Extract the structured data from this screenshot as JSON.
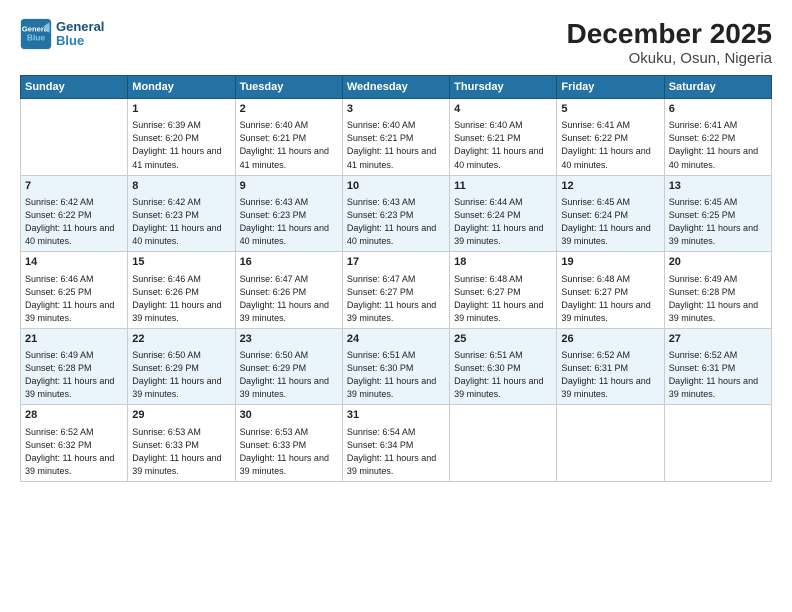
{
  "header": {
    "logo_line1": "General",
    "logo_line2": "Blue",
    "title": "December 2025",
    "subtitle": "Okuku, Osun, Nigeria"
  },
  "columns": [
    "Sunday",
    "Monday",
    "Tuesday",
    "Wednesday",
    "Thursday",
    "Friday",
    "Saturday"
  ],
  "weeks": [
    [
      {
        "day": "",
        "sunrise": "",
        "sunset": "",
        "daylight": ""
      },
      {
        "day": "1",
        "sunrise": "Sunrise: 6:39 AM",
        "sunset": "Sunset: 6:20 PM",
        "daylight": "Daylight: 11 hours and 41 minutes."
      },
      {
        "day": "2",
        "sunrise": "Sunrise: 6:40 AM",
        "sunset": "Sunset: 6:21 PM",
        "daylight": "Daylight: 11 hours and 41 minutes."
      },
      {
        "day": "3",
        "sunrise": "Sunrise: 6:40 AM",
        "sunset": "Sunset: 6:21 PM",
        "daylight": "Daylight: 11 hours and 41 minutes."
      },
      {
        "day": "4",
        "sunrise": "Sunrise: 6:40 AM",
        "sunset": "Sunset: 6:21 PM",
        "daylight": "Daylight: 11 hours and 40 minutes."
      },
      {
        "day": "5",
        "sunrise": "Sunrise: 6:41 AM",
        "sunset": "Sunset: 6:22 PM",
        "daylight": "Daylight: 11 hours and 40 minutes."
      },
      {
        "day": "6",
        "sunrise": "Sunrise: 6:41 AM",
        "sunset": "Sunset: 6:22 PM",
        "daylight": "Daylight: 11 hours and 40 minutes."
      }
    ],
    [
      {
        "day": "7",
        "sunrise": "Sunrise: 6:42 AM",
        "sunset": "Sunset: 6:22 PM",
        "daylight": "Daylight: 11 hours and 40 minutes."
      },
      {
        "day": "8",
        "sunrise": "Sunrise: 6:42 AM",
        "sunset": "Sunset: 6:23 PM",
        "daylight": "Daylight: 11 hours and 40 minutes."
      },
      {
        "day": "9",
        "sunrise": "Sunrise: 6:43 AM",
        "sunset": "Sunset: 6:23 PM",
        "daylight": "Daylight: 11 hours and 40 minutes."
      },
      {
        "day": "10",
        "sunrise": "Sunrise: 6:43 AM",
        "sunset": "Sunset: 6:23 PM",
        "daylight": "Daylight: 11 hours and 40 minutes."
      },
      {
        "day": "11",
        "sunrise": "Sunrise: 6:44 AM",
        "sunset": "Sunset: 6:24 PM",
        "daylight": "Daylight: 11 hours and 39 minutes."
      },
      {
        "day": "12",
        "sunrise": "Sunrise: 6:45 AM",
        "sunset": "Sunset: 6:24 PM",
        "daylight": "Daylight: 11 hours and 39 minutes."
      },
      {
        "day": "13",
        "sunrise": "Sunrise: 6:45 AM",
        "sunset": "Sunset: 6:25 PM",
        "daylight": "Daylight: 11 hours and 39 minutes."
      }
    ],
    [
      {
        "day": "14",
        "sunrise": "Sunrise: 6:46 AM",
        "sunset": "Sunset: 6:25 PM",
        "daylight": "Daylight: 11 hours and 39 minutes."
      },
      {
        "day": "15",
        "sunrise": "Sunrise: 6:46 AM",
        "sunset": "Sunset: 6:26 PM",
        "daylight": "Daylight: 11 hours and 39 minutes."
      },
      {
        "day": "16",
        "sunrise": "Sunrise: 6:47 AM",
        "sunset": "Sunset: 6:26 PM",
        "daylight": "Daylight: 11 hours and 39 minutes."
      },
      {
        "day": "17",
        "sunrise": "Sunrise: 6:47 AM",
        "sunset": "Sunset: 6:27 PM",
        "daylight": "Daylight: 11 hours and 39 minutes."
      },
      {
        "day": "18",
        "sunrise": "Sunrise: 6:48 AM",
        "sunset": "Sunset: 6:27 PM",
        "daylight": "Daylight: 11 hours and 39 minutes."
      },
      {
        "day": "19",
        "sunrise": "Sunrise: 6:48 AM",
        "sunset": "Sunset: 6:27 PM",
        "daylight": "Daylight: 11 hours and 39 minutes."
      },
      {
        "day": "20",
        "sunrise": "Sunrise: 6:49 AM",
        "sunset": "Sunset: 6:28 PM",
        "daylight": "Daylight: 11 hours and 39 minutes."
      }
    ],
    [
      {
        "day": "21",
        "sunrise": "Sunrise: 6:49 AM",
        "sunset": "Sunset: 6:28 PM",
        "daylight": "Daylight: 11 hours and 39 minutes."
      },
      {
        "day": "22",
        "sunrise": "Sunrise: 6:50 AM",
        "sunset": "Sunset: 6:29 PM",
        "daylight": "Daylight: 11 hours and 39 minutes."
      },
      {
        "day": "23",
        "sunrise": "Sunrise: 6:50 AM",
        "sunset": "Sunset: 6:29 PM",
        "daylight": "Daylight: 11 hours and 39 minutes."
      },
      {
        "day": "24",
        "sunrise": "Sunrise: 6:51 AM",
        "sunset": "Sunset: 6:30 PM",
        "daylight": "Daylight: 11 hours and 39 minutes."
      },
      {
        "day": "25",
        "sunrise": "Sunrise: 6:51 AM",
        "sunset": "Sunset: 6:30 PM",
        "daylight": "Daylight: 11 hours and 39 minutes."
      },
      {
        "day": "26",
        "sunrise": "Sunrise: 6:52 AM",
        "sunset": "Sunset: 6:31 PM",
        "daylight": "Daylight: 11 hours and 39 minutes."
      },
      {
        "day": "27",
        "sunrise": "Sunrise: 6:52 AM",
        "sunset": "Sunset: 6:31 PM",
        "daylight": "Daylight: 11 hours and 39 minutes."
      }
    ],
    [
      {
        "day": "28",
        "sunrise": "Sunrise: 6:52 AM",
        "sunset": "Sunset: 6:32 PM",
        "daylight": "Daylight: 11 hours and 39 minutes."
      },
      {
        "day": "29",
        "sunrise": "Sunrise: 6:53 AM",
        "sunset": "Sunset: 6:33 PM",
        "daylight": "Daylight: 11 hours and 39 minutes."
      },
      {
        "day": "30",
        "sunrise": "Sunrise: 6:53 AM",
        "sunset": "Sunset: 6:33 PM",
        "daylight": "Daylight: 11 hours and 39 minutes."
      },
      {
        "day": "31",
        "sunrise": "Sunrise: 6:54 AM",
        "sunset": "Sunset: 6:34 PM",
        "daylight": "Daylight: 11 hours and 39 minutes."
      },
      {
        "day": "",
        "sunrise": "",
        "sunset": "",
        "daylight": ""
      },
      {
        "day": "",
        "sunrise": "",
        "sunset": "",
        "daylight": ""
      },
      {
        "day": "",
        "sunrise": "",
        "sunset": "",
        "daylight": ""
      }
    ]
  ]
}
